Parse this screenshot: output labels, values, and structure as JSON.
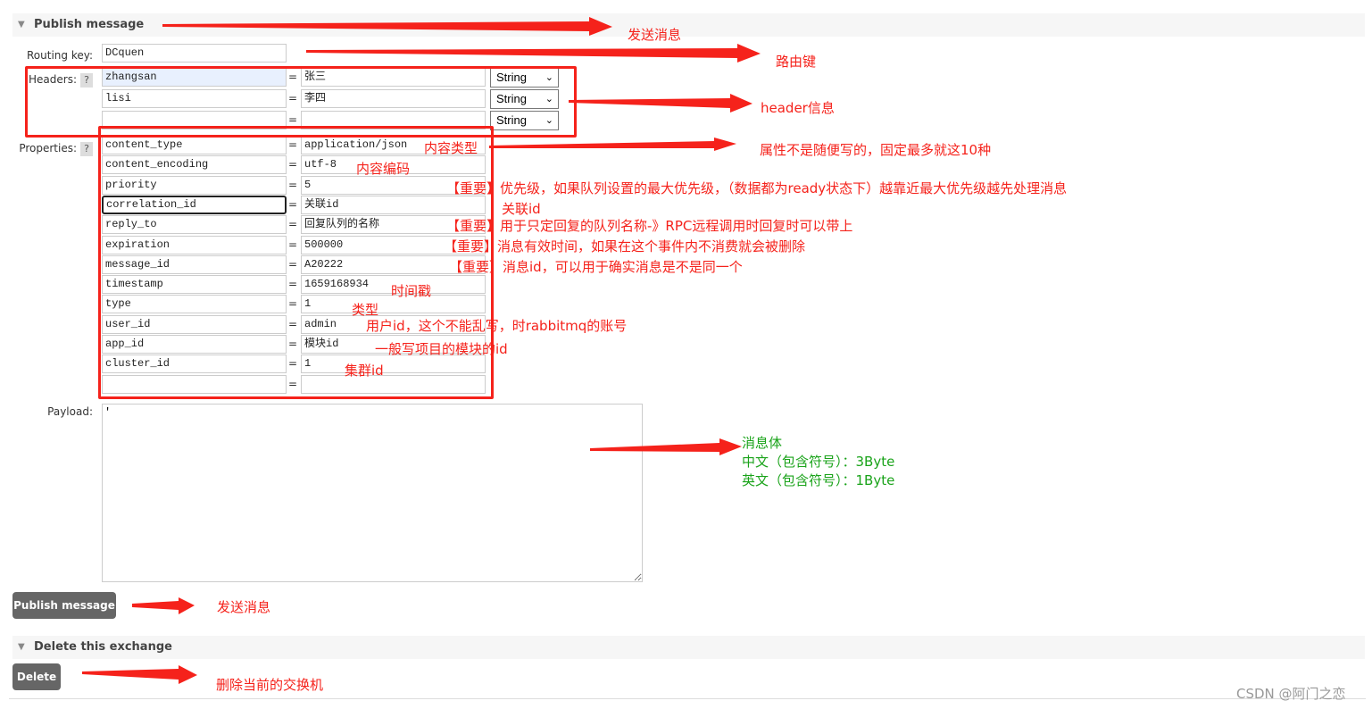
{
  "publish_section": {
    "title": "Publish message"
  },
  "routing_key": {
    "label": "Routing key:",
    "value": "DCquen"
  },
  "headers": {
    "label": "Headers:",
    "help": "?",
    "rows": [
      {
        "key": "zhangsan",
        "value": "张三",
        "type": "String"
      },
      {
        "key": "lisi",
        "value": "李四",
        "type": "String"
      },
      {
        "key": "",
        "value": "",
        "type": "String"
      }
    ]
  },
  "properties": {
    "label": "Properties:",
    "help": "?",
    "rows": [
      {
        "key": "content_type",
        "value": "application/json"
      },
      {
        "key": "content_encoding",
        "value": "utf-8"
      },
      {
        "key": "priority",
        "value": "5"
      },
      {
        "key": "correlation_id",
        "value": "关联id"
      },
      {
        "key": "reply_to",
        "value": "回复队列的名称"
      },
      {
        "key": "expiration",
        "value": "500000"
      },
      {
        "key": "message_id",
        "value": "A20222"
      },
      {
        "key": "timestamp",
        "value": "1659168934"
      },
      {
        "key": "type",
        "value": "1"
      },
      {
        "key": "user_id",
        "value": "admin"
      },
      {
        "key": "app_id",
        "value": "模块id"
      },
      {
        "key": "cluster_id",
        "value": "1"
      },
      {
        "key": "",
        "value": ""
      }
    ]
  },
  "payload": {
    "label": "Payload:",
    "value": "'"
  },
  "publish_button": "Publish message",
  "delete_section": {
    "title": "Delete this exchange"
  },
  "delete_button": "Delete",
  "annotations": {
    "publish_title": "发送消息",
    "routing_key": "路由键",
    "headers": "header信息",
    "properties": "属性不是随便写的，固定最多就这10种",
    "content_type": "内容类型",
    "content_encoding": "内容编码",
    "priority": "【重要】优先级，如果队列设置的最大优先级，（数据都为ready状态下）越靠近最大优先级越先处理消息",
    "correlation_id": "关联id",
    "reply_to": "【重要】用于只定回复的队列名称-》RPC远程调用时回复时可以带上",
    "expiration": "【重要】消息有效时间，如果在这个事件内不消费就会被删除",
    "message_id": "【重要】消息id，可以用于确实消息是不是同一个",
    "timestamp": "时间戳",
    "type": "类型",
    "user_id": "用户id，这个不能乱写，时rabbitmq的账号",
    "app_id": "一般写项目的模块的id",
    "cluster_id": "集群id",
    "payload_1": "消息体",
    "payload_2": "中文（包含符号）：3Byte",
    "payload_3": "英文（包含符号）：1Byte",
    "publish_button": "发送消息",
    "delete_button": "删除当前的交换机"
  },
  "watermark": "CSDN @阿门之恋",
  "colors": {
    "annotation": "#f5221b",
    "annotation_green": "#1aa31a",
    "button": "#666666"
  }
}
